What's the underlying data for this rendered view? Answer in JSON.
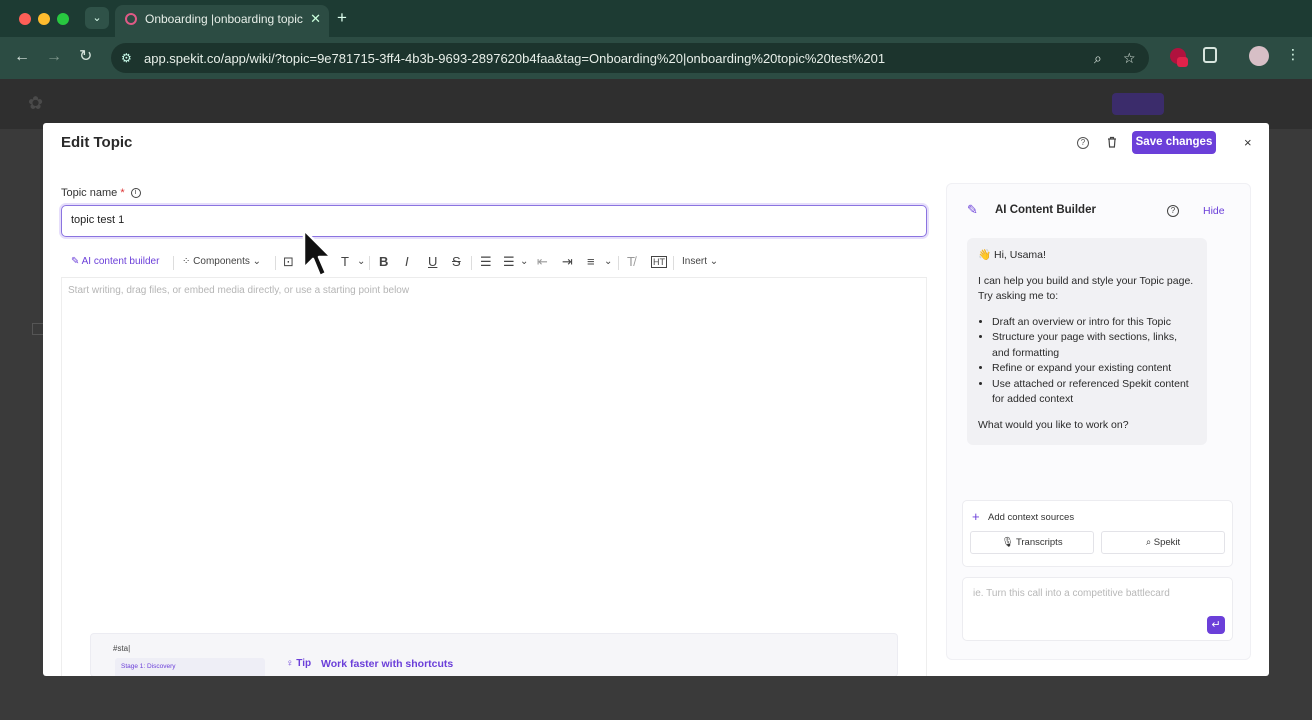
{
  "browser": {
    "tab_title": "Onboarding |onboarding topic",
    "url": "app.spekit.co/app/wiki/?topic=9e781715-3ff4-4b3b-9693-2897620b4faa&tag=Onboarding%20|onboarding%20topic%20test%201"
  },
  "modal": {
    "title": "Edit Topic",
    "save_label": "Save changes",
    "close_glyph": "×",
    "topic_name_label": "Topic name",
    "required_mark": "*",
    "topic_name_value": "topic test 1",
    "editor_placeholder": "Start writing, drag files, or embed media directly, or use a starting point below"
  },
  "editor_toolbar": {
    "ai_label": "AI content builder",
    "components_label": "Components",
    "insert_label": "Insert"
  },
  "tip": {
    "snippet": "#sta|",
    "stage": "Stage 1: Discovery",
    "label": "Tip",
    "text": "Work faster with shortcuts"
  },
  "ai_panel": {
    "title": "AI Content Builder",
    "hide_label": "Hide",
    "greeting": "👋 Hi, Usama!",
    "intro": "I can help you build and style your Topic page. Try asking me to:",
    "suggestions": [
      "Draft an overview or intro for this Topic",
      "Structure your page with sections, links, and formatting",
      "Refine or expand your existing content",
      "Use attached or referenced Spekit content for added context"
    ],
    "question": "What would you like to work on?",
    "context_title": "Add context sources",
    "context_buttons": [
      "Transcripts",
      "Spekit"
    ],
    "prompt_placeholder": "ie. Turn this call into a competitive battlecard"
  },
  "colors": {
    "accent": "#6b3fd9",
    "browser_chrome": "#2c4c43"
  }
}
